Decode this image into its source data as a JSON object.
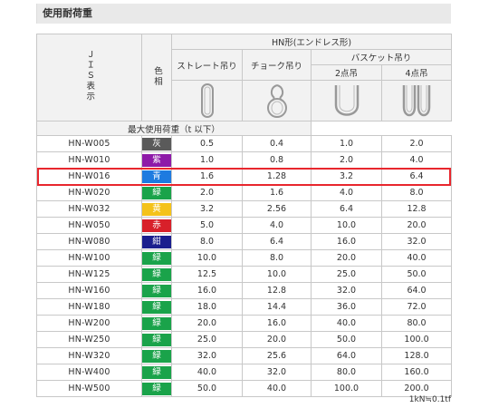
{
  "section_title": "使用耐荷重",
  "header": {
    "jis": "ＪＩＳ表示",
    "color": "色相",
    "hn_type": "HN形(エンドレス形)",
    "straight": "ストレート吊り",
    "choke": "チョーク吊り",
    "basket": "バスケット吊り",
    "two_point": "2点吊",
    "four_point": "4点吊",
    "max_load": "最大使用荷重（t 以下）"
  },
  "rows": [
    {
      "code": "HN-W005",
      "color_name": "灰",
      "color": "#5a5a5a",
      "straight": "0.5",
      "choke": "0.4",
      "two": "1.0",
      "four": "2.0"
    },
    {
      "code": "HN-W010",
      "color_name": "紫",
      "color": "#8e1aa8",
      "straight": "1.0",
      "choke": "0.8",
      "two": "2.0",
      "four": "4.0"
    },
    {
      "code": "HN-W016",
      "color_name": "青",
      "color": "#1e7be0",
      "straight": "1.6",
      "choke": "1.28",
      "two": "3.2",
      "four": "6.4"
    },
    {
      "code": "HN-W020",
      "color_name": "緑",
      "color": "#1aa34a",
      "straight": "2.0",
      "choke": "1.6",
      "two": "4.0",
      "four": "8.0"
    },
    {
      "code": "HN-W032",
      "color_name": "黄",
      "color": "#f4c21a",
      "straight": "3.2",
      "choke": "2.56",
      "two": "6.4",
      "four": "12.8"
    },
    {
      "code": "HN-W050",
      "color_name": "赤",
      "color": "#d8202a",
      "straight": "5.0",
      "choke": "4.0",
      "two": "10.0",
      "four": "20.0"
    },
    {
      "code": "HN-W080",
      "color_name": "紺",
      "color": "#1a1e8e",
      "straight": "8.0",
      "choke": "6.4",
      "two": "16.0",
      "four": "32.0"
    },
    {
      "code": "HN-W100",
      "color_name": "緑",
      "color": "#1aa34a",
      "straight": "10.0",
      "choke": "8.0",
      "two": "20.0",
      "four": "40.0"
    },
    {
      "code": "HN-W125",
      "color_name": "緑",
      "color": "#1aa34a",
      "straight": "12.5",
      "choke": "10.0",
      "two": "25.0",
      "four": "50.0"
    },
    {
      "code": "HN-W160",
      "color_name": "緑",
      "color": "#1aa34a",
      "straight": "16.0",
      "choke": "12.8",
      "two": "32.0",
      "four": "64.0"
    },
    {
      "code": "HN-W180",
      "color_name": "緑",
      "color": "#1aa34a",
      "straight": "18.0",
      "choke": "14.4",
      "two": "36.0",
      "four": "72.0"
    },
    {
      "code": "HN-W200",
      "color_name": "緑",
      "color": "#1aa34a",
      "straight": "20.0",
      "choke": "16.0",
      "two": "40.0",
      "four": "80.0"
    },
    {
      "code": "HN-W250",
      "color_name": "緑",
      "color": "#1aa34a",
      "straight": "25.0",
      "choke": "20.0",
      "two": "50.0",
      "four": "100.0"
    },
    {
      "code": "HN-W320",
      "color_name": "緑",
      "color": "#1aa34a",
      "straight": "32.0",
      "choke": "25.6",
      "two": "64.0",
      "four": "128.0"
    },
    {
      "code": "HN-W400",
      "color_name": "緑",
      "color": "#1aa34a",
      "straight": "40.0",
      "choke": "32.0",
      "two": "80.0",
      "four": "160.0"
    },
    {
      "code": "HN-W500",
      "color_name": "緑",
      "color": "#1aa34a",
      "straight": "50.0",
      "choke": "40.0",
      "two": "100.0",
      "four": "200.0"
    }
  ],
  "highlighted_code": "HN-W016",
  "note": "1kN≒0.1tf"
}
